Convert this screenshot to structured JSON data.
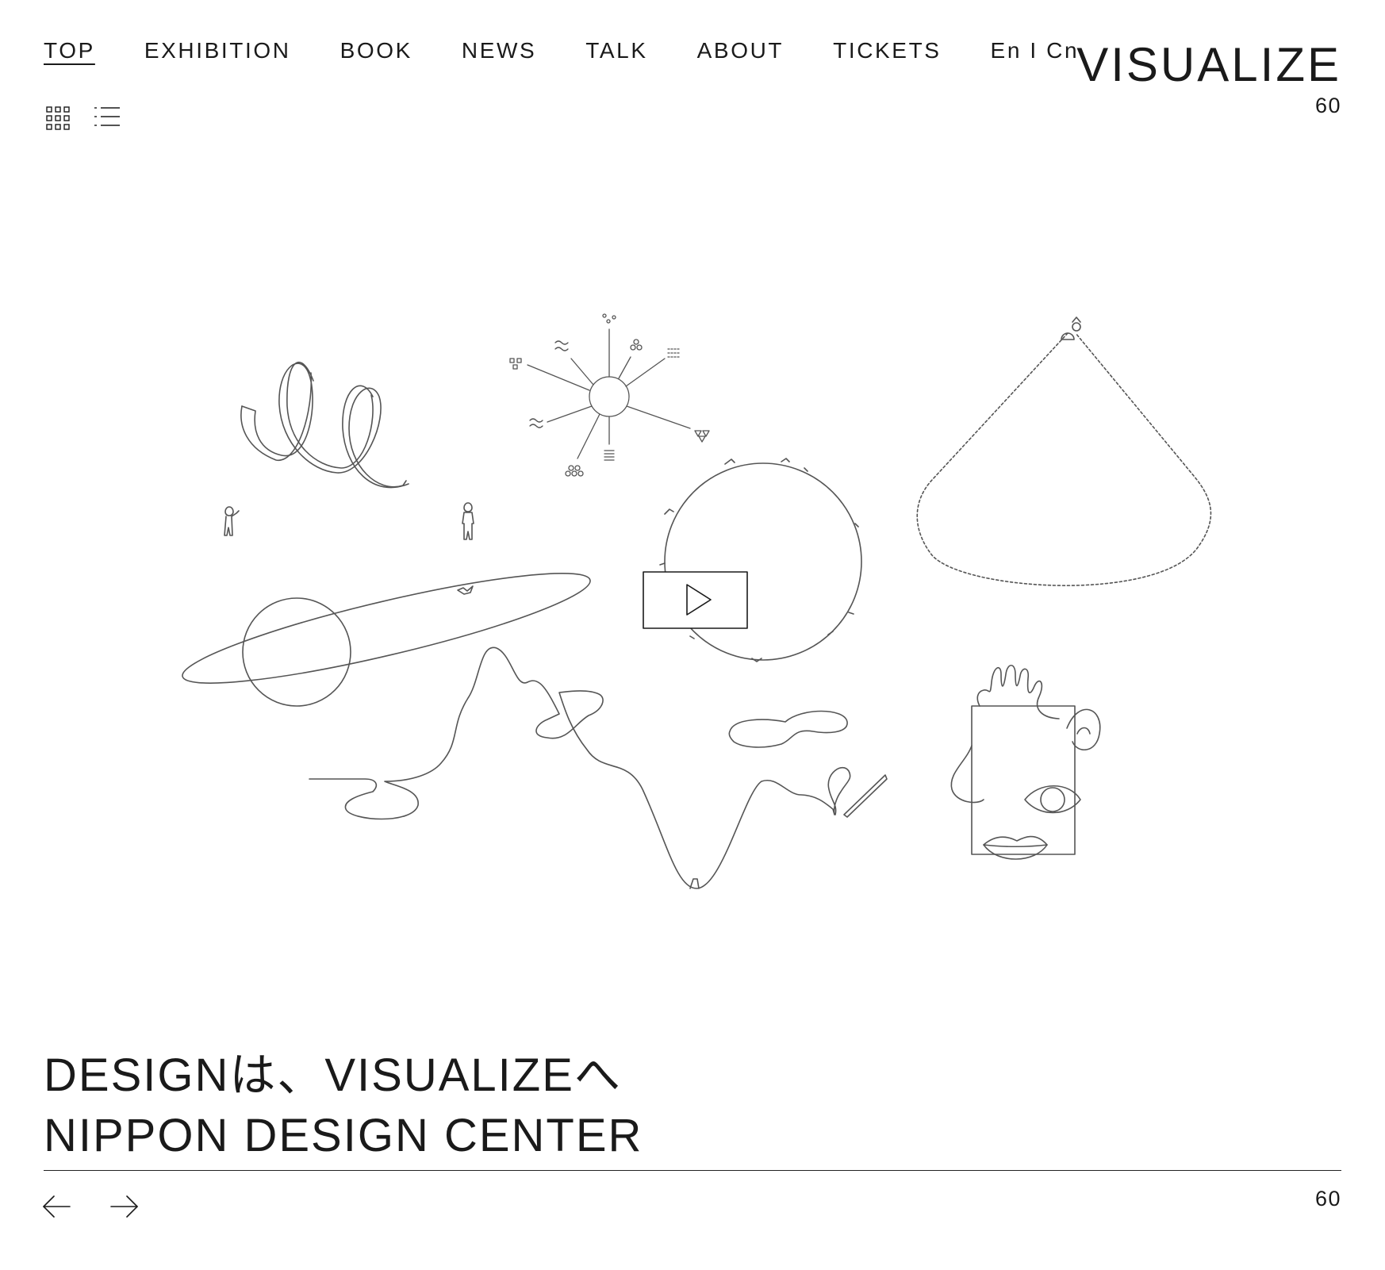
{
  "nav": {
    "items": [
      {
        "label": "TOP",
        "active": true
      },
      {
        "label": "EXHIBITION",
        "active": false
      },
      {
        "label": "BOOK",
        "active": false
      },
      {
        "label": "NEWS",
        "active": false
      },
      {
        "label": "TALK",
        "active": false
      },
      {
        "label": "ABOUT",
        "active": false
      },
      {
        "label": "TICKETS",
        "active": false
      },
      {
        "label": "En I Cn",
        "active": false
      }
    ]
  },
  "logo": {
    "title": "VISUALIZE",
    "number": "60"
  },
  "view_toggle": {
    "grid_icon": "grid-icon",
    "list_icon": "list-icon"
  },
  "hero": {
    "play_icon": "play-icon"
  },
  "headline": {
    "line1": "DESIGNは、VISUALIZEへ",
    "line2": "NIPPON DESIGN CENTER"
  },
  "pager": {
    "prev_icon": "arrow-left-icon",
    "next_icon": "arrow-right-icon",
    "count": "60"
  },
  "colors": {
    "ink": "#1a1a1a",
    "background": "#ffffff",
    "line": "#555555"
  }
}
